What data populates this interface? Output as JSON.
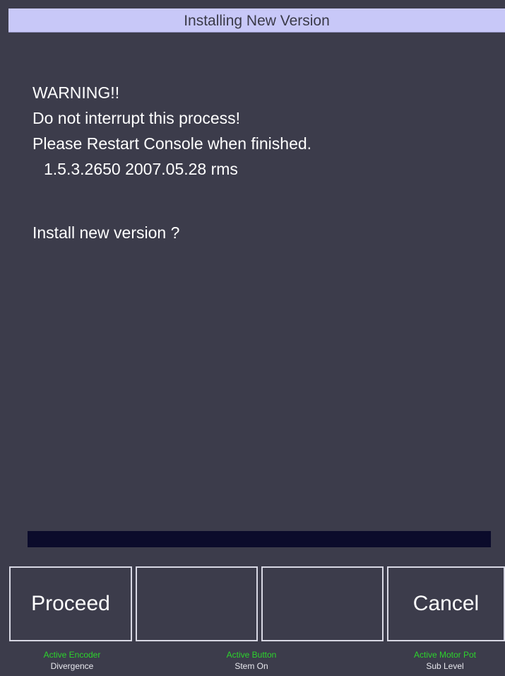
{
  "window": {
    "title": "Installing New Version"
  },
  "message": {
    "warning": "WARNING!!",
    "no_interrupt": "Do not interrupt this process!",
    "restart": "Please Restart Console when finished.",
    "version": "1.5.3.2650 2007.05.28 rms",
    "question": "Install new version ?"
  },
  "progress": {
    "fraction": 0.0,
    "track_color": "#0b0b2b"
  },
  "softkeys": {
    "proceed_label": "Proceed",
    "key2_label": "",
    "key3_label": "",
    "cancel_label": "Cancel"
  },
  "status": {
    "encoder_label": "Active Encoder",
    "encoder_value": "Divergence",
    "button_label": "Active Button",
    "button_value": "Stem On",
    "motor_pot_label": "Active Motor Pot",
    "motor_pot_value": "Sub Level"
  },
  "colors": {
    "background": "#3c3c4b",
    "title_bar": "#c8c8f8",
    "status_label": "#2cd42c"
  }
}
